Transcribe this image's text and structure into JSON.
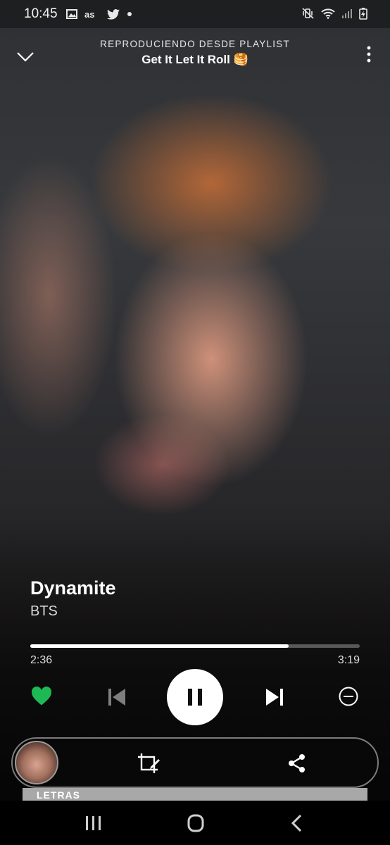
{
  "status_bar": {
    "time": "10:45",
    "left_icons": [
      "image-icon",
      "lastfm-icon",
      "twitter-icon",
      "dot-icon"
    ],
    "right_icons": [
      "mute-vibrate-icon",
      "wifi-icon",
      "signal-icon",
      "battery-charging-icon"
    ]
  },
  "header": {
    "context_label": "REPRODUCIENDO DESDE PLAYLIST",
    "playlist_name": "Get It Let It Roll 🥞"
  },
  "track": {
    "title": "Dynamite",
    "artist": "BTS"
  },
  "progress": {
    "elapsed": "2:36",
    "total": "3:19",
    "fraction": 0.784
  },
  "controls": {
    "liked": true,
    "accent_color": "#1DB954",
    "state": "playing"
  },
  "lyrics": {
    "label": "LETRAS"
  }
}
